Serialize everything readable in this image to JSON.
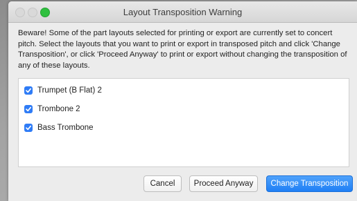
{
  "window": {
    "title": "Layout Transposition Warning"
  },
  "message": "Beware! Some of the part layouts selected for printing or export are currently set to concert pitch. Select the layouts that you want to print or export in transposed pitch and click 'Change Transposition', or click 'Proceed Anyway' to print or export without changing the transposition of any of these layouts.",
  "layouts": [
    {
      "label": "Trumpet (B Flat) 2",
      "checked": true
    },
    {
      "label": "Trombone 2",
      "checked": true
    },
    {
      "label": "Bass Trombone",
      "checked": true
    }
  ],
  "buttons": {
    "cancel": "Cancel",
    "proceed": "Proceed Anyway",
    "change": "Change Transposition"
  },
  "colors": {
    "accent": "#2f7cf6",
    "maximize": "#2fc03f"
  }
}
